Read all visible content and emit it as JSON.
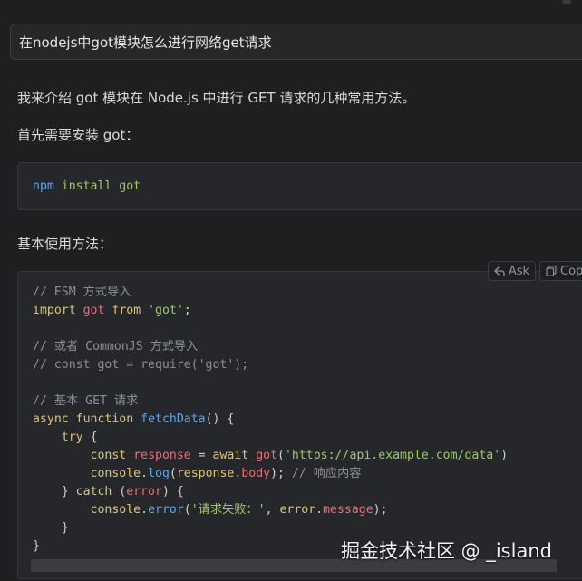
{
  "prompt": {
    "text": "在nodejs中got模块怎么进行网络get请求"
  },
  "answer": {
    "intro": "我来介绍 got 模块在 Node.js 中进行 GET 请求的几种常用方法。",
    "install_label": "首先需要安装 got：",
    "install_code": {
      "cmd": "npm",
      "rest": " install got"
    },
    "basic_label": "基本使用方法："
  },
  "code_toolbar": {
    "ask_label": "Ask",
    "copy_label": "Copy",
    "ask_icon": "reply-arrow-icon",
    "copy_icon": "copy-icon"
  },
  "code_main": {
    "lines": [
      "// ESM 方式导入",
      "import got from 'got';",
      "",
      "// 或者 CommonJS 方式导入",
      "// const got = require('got');",
      "",
      "// 基本 GET 请求",
      "async function fetchData() {",
      "    try {",
      "        const response = await got('https://api.example.com/data')",
      "        console.log(response.body); // 响应内容",
      "    } catch (error) {",
      "        console.error('请求失败：', error.message);",
      "    }",
      "}"
    ]
  },
  "watermark": "掘金技术社区 @ _island",
  "colors": {
    "background": "#1e1f21",
    "code_background": "#25272b",
    "keyword": "#c678dd",
    "string": "#98c379",
    "function": "#61afef",
    "comment": "#8b8f96"
  }
}
